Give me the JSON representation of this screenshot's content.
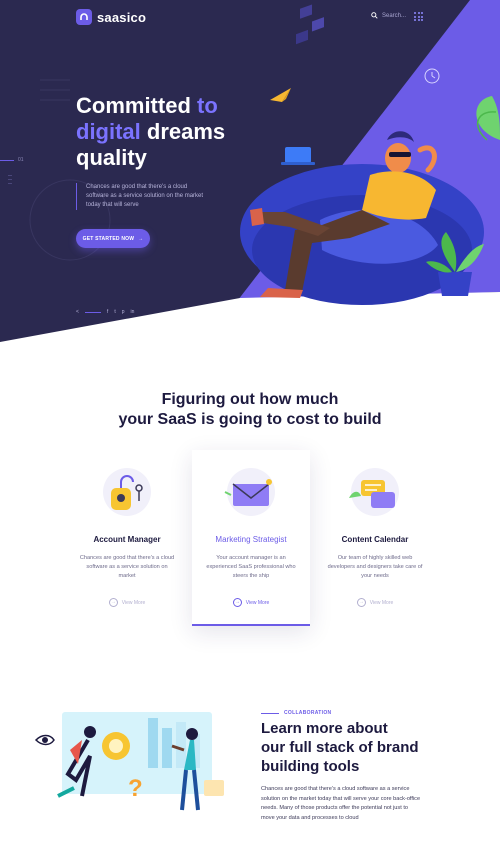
{
  "brand": {
    "name": "saasico",
    "accent": "#6c5ce7",
    "hero_bg": "#2b2950"
  },
  "header": {
    "search_placeholder": "Search...",
    "menu_icon": "grid-dots-icon"
  },
  "hero": {
    "headline_line1_a": "Committed ",
    "headline_line1_b": "to",
    "headline_line2_a": "digital",
    "headline_line2_b": " dreams",
    "headline_line3": "quality",
    "slide_number": "01",
    "subtitle": "Chances are good that there's a cloud software as a service solution on the market today that will serve",
    "cta_label": "GET STARTED NOW",
    "cta_arrow": "→",
    "social": [
      "f",
      "t",
      "p",
      "in"
    ]
  },
  "pricing": {
    "title_line1": "Figuring out how much",
    "title_line2": "your SaaS is going to cost to build",
    "cards": [
      {
        "title": "Account Manager",
        "desc": "Chances are good that there's a cloud software as a service solution on market",
        "link": "View More"
      },
      {
        "title": "Marketing Strategist",
        "desc": "Your account manager is an experienced SaaS professional who steers the ship",
        "link": "View More"
      },
      {
        "title": "Content Calendar",
        "desc": "Our team of highly skilled web developers and designers take care of your needs",
        "link": "View More"
      }
    ]
  },
  "collaboration": {
    "label": "COLLABORATION",
    "title_line1": "Learn more about",
    "title_line2": "our full stack of brand",
    "title_line3": "building tools",
    "text": "Chances are good that there's a cloud software as a service solution on the market today that will serve your core back-office needs. Many of those products offer the potential not just to move your data and processes to cloud"
  }
}
